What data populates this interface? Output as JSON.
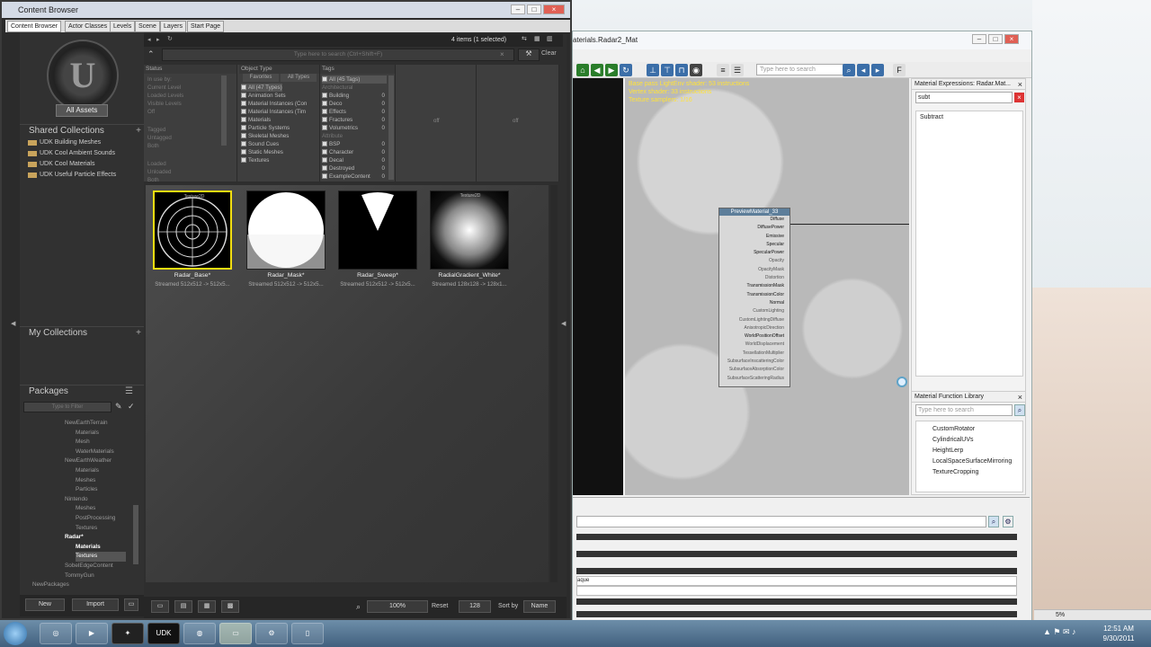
{
  "content_browser": {
    "title": "Content Browser",
    "tabs": [
      "Content Browser",
      "Actor Classes",
      "Levels",
      "Scene",
      "Layers",
      "Start Page"
    ],
    "items_count": "4 items (1 selected)",
    "search_placeholder": "Type here to search (Ctrl+Shift+F)",
    "clear_label": "Clear",
    "all_assets_label": "All Assets",
    "shared_collections": {
      "header": "Shared Collections",
      "items": [
        "UDK Building Meshes",
        "UDK Cool Ambient Sounds",
        "UDK Cool Materials",
        "UDK Useful Particle Effects"
      ]
    },
    "my_collections_header": "My Collections",
    "packages_header": "Packages",
    "filter_placeholder": "Type to Filter",
    "packages": [
      {
        "label": "NewEarthTerrain",
        "level": 1,
        "style": "dim"
      },
      {
        "label": "Materials",
        "level": 2,
        "style": "dim"
      },
      {
        "label": "Mesh",
        "level": 2,
        "style": "dim"
      },
      {
        "label": "WaterMaterials",
        "level": 2,
        "style": "dim"
      },
      {
        "label": "NewEarthWeather",
        "level": 1,
        "style": "dim"
      },
      {
        "label": "Materials",
        "level": 2,
        "style": "dim"
      },
      {
        "label": "Meshes",
        "level": 2,
        "style": "dim"
      },
      {
        "label": "Particles",
        "level": 2,
        "style": "dim"
      },
      {
        "label": "Nintendo",
        "level": 1,
        "style": "dim"
      },
      {
        "label": "Meshes",
        "level": 2,
        "style": "dim"
      },
      {
        "label": "PostProcessing",
        "level": 2,
        "style": "dim"
      },
      {
        "label": "Textures",
        "level": 2,
        "style": "dim"
      },
      {
        "label": "Radar*",
        "level": 1,
        "style": "bright"
      },
      {
        "label": "Materials",
        "level": 2,
        "style": "bright"
      },
      {
        "label": "Textures",
        "level": 2,
        "style": "selected"
      },
      {
        "label": "SobelEdgeContent",
        "level": 1,
        "style": "dim"
      },
      {
        "label": "TommyGun",
        "level": 1,
        "style": "dim"
      },
      {
        "label": "NewPackages",
        "level": 0,
        "style": "dim"
      }
    ],
    "status": {
      "header": "Status",
      "rows": [
        "In use by:",
        "Current Level",
        "Loaded Levels",
        "Visible Levels",
        "Off",
        "Tagged",
        "Untagged",
        "Both",
        "Loaded",
        "Unloaded",
        "Both"
      ]
    },
    "object_type": {
      "header": "Object Type",
      "sub_tabs": [
        "Favorites",
        "All Types"
      ],
      "rows": [
        "All (47 Types)",
        "Animation Sets",
        "Material Instances (Con",
        "Material Instances (Tim",
        "Materials",
        "Particle Systems",
        "Skeletal Meshes",
        "Sound Cues",
        "Static Meshes",
        "Textures"
      ]
    },
    "tags": {
      "header": "Tags",
      "rows": [
        {
          "label": "All (45 Tags)",
          "count": ""
        },
        {
          "label": "Architectural",
          "count": "",
          "group": true
        },
        {
          "label": "Building",
          "count": "0"
        },
        {
          "label": "Deco",
          "count": "0"
        },
        {
          "label": "Effects",
          "count": "0"
        },
        {
          "label": "Fractures",
          "count": "0"
        },
        {
          "label": "Volumetrics",
          "count": "0"
        },
        {
          "label": "Attribute",
          "count": "",
          "group": true
        },
        {
          "label": "BSP",
          "count": "0"
        },
        {
          "label": "Character",
          "count": "0"
        },
        {
          "label": "Decal",
          "count": "0"
        },
        {
          "label": "Destroyed",
          "count": "0"
        },
        {
          "label": "ExampleContent",
          "count": "0"
        }
      ]
    },
    "off_labels": [
      "off",
      "off"
    ],
    "assets": [
      {
        "name": "Radar_Base*",
        "info": "Streamed 512x512 -> 512x5...",
        "tag": "Texture2D",
        "selected": true
      },
      {
        "name": "Radar_Mask*",
        "info": "Streamed 512x512 -> 512x5...",
        "tag": "",
        "selected": false
      },
      {
        "name": "Radar_Sweep*",
        "info": "Streamed 512x512 -> 512x5...",
        "tag": "",
        "selected": false
      },
      {
        "name": "RadialGradient_White*",
        "info": "Streamed 128x128 -> 128x1...",
        "tag": "Texture2D",
        "selected": false
      }
    ],
    "bottom": {
      "new_label": "New",
      "import_label": "Import",
      "zoom_value": "100%",
      "reset_label": "Reset",
      "size_value": "128",
      "sort_label": "Sort by",
      "sort_value": "Name"
    }
  },
  "material_editor": {
    "title": "aterials.Radar2_Mat",
    "search_placeholder": "Type here to search",
    "stats": [
      "Base pass LightEnv shader: 53 instructions",
      "Vertex shader: 33 instructions",
      "Texture samplers: 1/16"
    ],
    "node_title": "PreviewMaterial_33",
    "node_pins": [
      "Diffuse",
      "DiffusePower",
      "Emissive",
      "Specular",
      "SpecularPower",
      "Opacity",
      "OpacityMask",
      "Distortion",
      "TransmissionMask",
      "TransmissionColor",
      "Normal",
      "CustomLighting",
      "CustomLightingDiffuse",
      "AnisotropicDirection",
      "WorldPositionOffset",
      "WorldDisplacement",
      "TessellationMultiplier",
      "SubsurfaceInscatteringColor",
      "SubsurfaceAbsorptionColor",
      "SubsurfaceScatteringRadius"
    ],
    "active_pins": [
      "Diffuse",
      "DiffusePower",
      "Emissive",
      "Specular",
      "SpecularPower",
      "TransmissionMask",
      "TransmissionColor",
      "Normal",
      "WorldPositionOffset"
    ],
    "expressions_title": "Material Expressions: Radar.Mat...",
    "expressions_filter": "subt",
    "expressions_result": "Subtract",
    "function_library_title": "Material Function Library",
    "function_search_placeholder": "Type here to search",
    "functions": [
      "CustomRotator",
      "CylindricalUVs",
      "HeightLerp",
      "LocalSpaceSurfaceMirroring",
      "TextureCropping"
    ],
    "prop_rows": [
      "aque",
      ""
    ]
  },
  "taskbar": {
    "time": "12:51 AM",
    "date": "9/30/2011",
    "udk_label": "UDK",
    "percent_label": "5%"
  }
}
